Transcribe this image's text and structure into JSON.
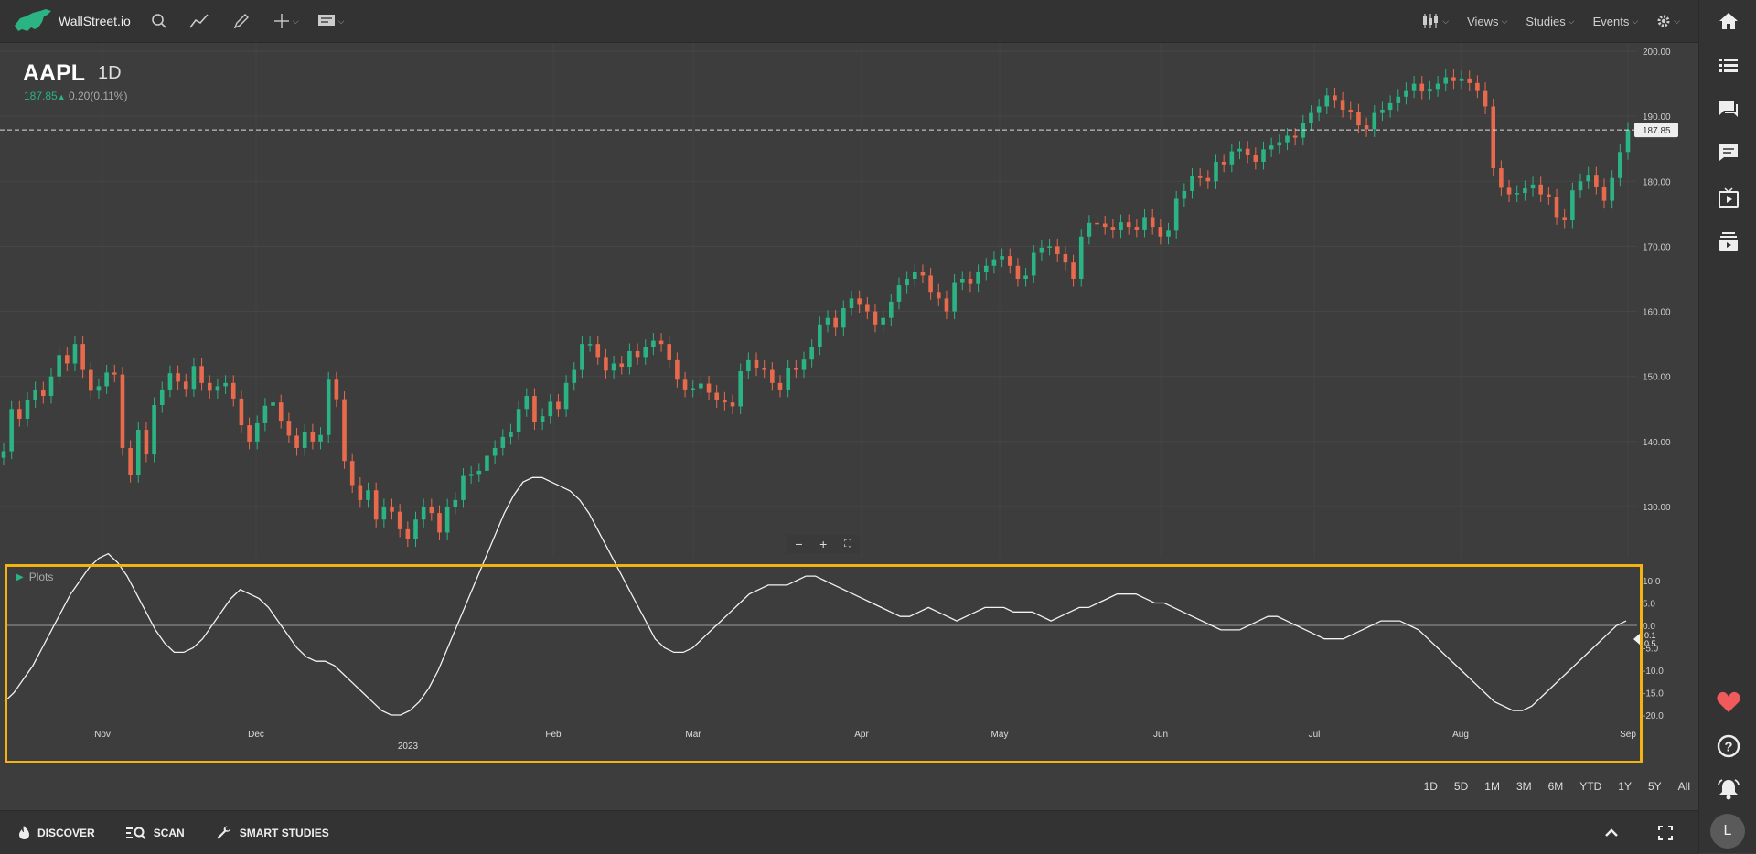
{
  "app": {
    "logo_text": "WallStreet.io"
  },
  "toolbar": {
    "views_label": "Views",
    "studies_label": "Studies",
    "events_label": "Events"
  },
  "symbol": {
    "ticker": "AAPL",
    "interval": "1D",
    "price": "187.85",
    "change": "0.20(0.11%)",
    "up_color": "#2bb383",
    "down_color": "#e86a4c"
  },
  "price_axis": {
    "ticks": [
      "200.00",
      "190.00",
      "180.00",
      "170.00",
      "160.00",
      "150.00",
      "140.00",
      "130.00"
    ],
    "current_label": "187.85"
  },
  "indicator_panel": {
    "title": "Plots",
    "ticks": [
      "10.0",
      "5.0",
      "0.0",
      "-5.0",
      "-10.0",
      "-15.0",
      "-20.0"
    ],
    "value_label": "0.1",
    "value_label_bottom": "0.5"
  },
  "time_axis": {
    "labels": [
      "Nov",
      "Dec",
      "Feb",
      "Mar",
      "Apr",
      "May",
      "Jun",
      "Jul",
      "Aug",
      "Sep"
    ],
    "year_label": "2023"
  },
  "range_buttons": [
    "1D",
    "5D",
    "1M",
    "3M",
    "6M",
    "YTD",
    "1Y",
    "5Y",
    "All"
  ],
  "bottom_bar": {
    "discover_label": "DISCOVER",
    "scan_label": "SCAN",
    "smart_studies_label": "SMART STUDIES"
  },
  "user": {
    "avatar_initial": "L"
  },
  "chart_data": {
    "type": "candlestick",
    "title": "AAPL 1D",
    "x_range": [
      "2022-10-14",
      "2023-09-01"
    ],
    "y_range": [
      124,
      200
    ],
    "closes": [
      138.5,
      145,
      143.5,
      146.4,
      148,
      147,
      150,
      153.3,
      152,
      155,
      151,
      147.8,
      148.5,
      150.6,
      150.3,
      139,
      134.9,
      141.8,
      138,
      145.6,
      148,
      150.5,
      149.2,
      148.1,
      151.6,
      149,
      147.8,
      148.5,
      149,
      146.6,
      142.5,
      140,
      142.8,
      145.5,
      146,
      143.2,
      140.9,
      139,
      141.5,
      140,
      141,
      149.5,
      146.5,
      137,
      133.3,
      131,
      132.5,
      128,
      130,
      129.2,
      126.5,
      125,
      128,
      130,
      129,
      126,
      130,
      131,
      134.7,
      135,
      135.5,
      137.8,
      139,
      140.7,
      141.5,
      145,
      147,
      143,
      143.9,
      146.1,
      145,
      149,
      151,
      155,
      155,
      153,
      150.9,
      152,
      151.5,
      153.9,
      153,
      154.5,
      155.5,
      155,
      152.5,
      149.5,
      148,
      148.2,
      148.9,
      147.5,
      146.4,
      146,
      145.4,
      150.8,
      152.5,
      151.3,
      151,
      149,
      148,
      151.3,
      151,
      152.6,
      154.5,
      158,
      159,
      157.5,
      160.5,
      162,
      161,
      160,
      158,
      159,
      161.5,
      164,
      165,
      166,
      165.5,
      163,
      162,
      160,
      164.5,
      165,
      164.2,
      166,
      167,
      168,
      168.5,
      167,
      165,
      165.5,
      169,
      169.8,
      170,
      168.8,
      167.5,
      165,
      171.5,
      173.6,
      173.5,
      173,
      172.5,
      173.7,
      173,
      172.6,
      174.5,
      173,
      171.5,
      172.4,
      177.3,
      178.5,
      180.8,
      180.5,
      180,
      183,
      182.6,
      184.6,
      185,
      184,
      183,
      184.9,
      185.5,
      186,
      187,
      186.7,
      189,
      190.5,
      191.5,
      193.2,
      192.5,
      191,
      190.7,
      188.6,
      188,
      190.5,
      191,
      192,
      193,
      194,
      195,
      193.8,
      194.2,
      195,
      196,
      195.4,
      195.8,
      195.1,
      194,
      191.5,
      182,
      179,
      178,
      178.2,
      178.9,
      179.5,
      178,
      177.6,
      174.5,
      174,
      178.6,
      180,
      181,
      179.2,
      177,
      180.5,
      184.5,
      187.9
    ],
    "indicator_series": [
      -17,
      -15,
      -12,
      -9,
      -5,
      -1,
      3,
      7,
      10,
      13,
      15,
      16,
      14,
      11,
      7,
      3,
      -1,
      -4,
      -6,
      -6,
      -5,
      -3,
      0,
      3,
      6,
      8,
      7,
      6,
      4,
      1,
      -2,
      -5,
      -7,
      -8,
      -8,
      -9,
      -11,
      -13,
      -15,
      -17,
      -19,
      -20,
      -20,
      -19,
      -17,
      -14,
      -10,
      -5,
      0,
      5,
      10,
      15,
      20,
      25,
      29,
      32,
      33,
      33,
      32,
      31,
      30,
      28,
      25,
      21,
      17,
      13,
      9,
      5,
      1,
      -3,
      -5,
      -6,
      -6,
      -5,
      -3,
      -1,
      1,
      3,
      5,
      7,
      8,
      9,
      9,
      9,
      10,
      11,
      11,
      10,
      9,
      8,
      7,
      6,
      5,
      4,
      3,
      2,
      2,
      3,
      4,
      3,
      2,
      1,
      2,
      3,
      4,
      4,
      4,
      3,
      3,
      3,
      2,
      1,
      2,
      3,
      4,
      4,
      5,
      6,
      7,
      7,
      7,
      6,
      5,
      5,
      4,
      3,
      2,
      1,
      0,
      -1,
      -1,
      -1,
      0,
      1,
      2,
      2,
      1,
      0,
      -1,
      -2,
      -3,
      -3,
      -3,
      -2,
      -1,
      0,
      1,
      1,
      1,
      0,
      -1,
      -3,
      -5,
      -7,
      -9,
      -11,
      -13,
      -15,
      -17,
      -18,
      -19,
      -19,
      -18,
      -16,
      -14,
      -12,
      -10,
      -8,
      -6,
      -4,
      -2,
      0,
      1
    ],
    "indicator_zero_line": 0,
    "indicator_range": [
      -22,
      11
    ]
  }
}
